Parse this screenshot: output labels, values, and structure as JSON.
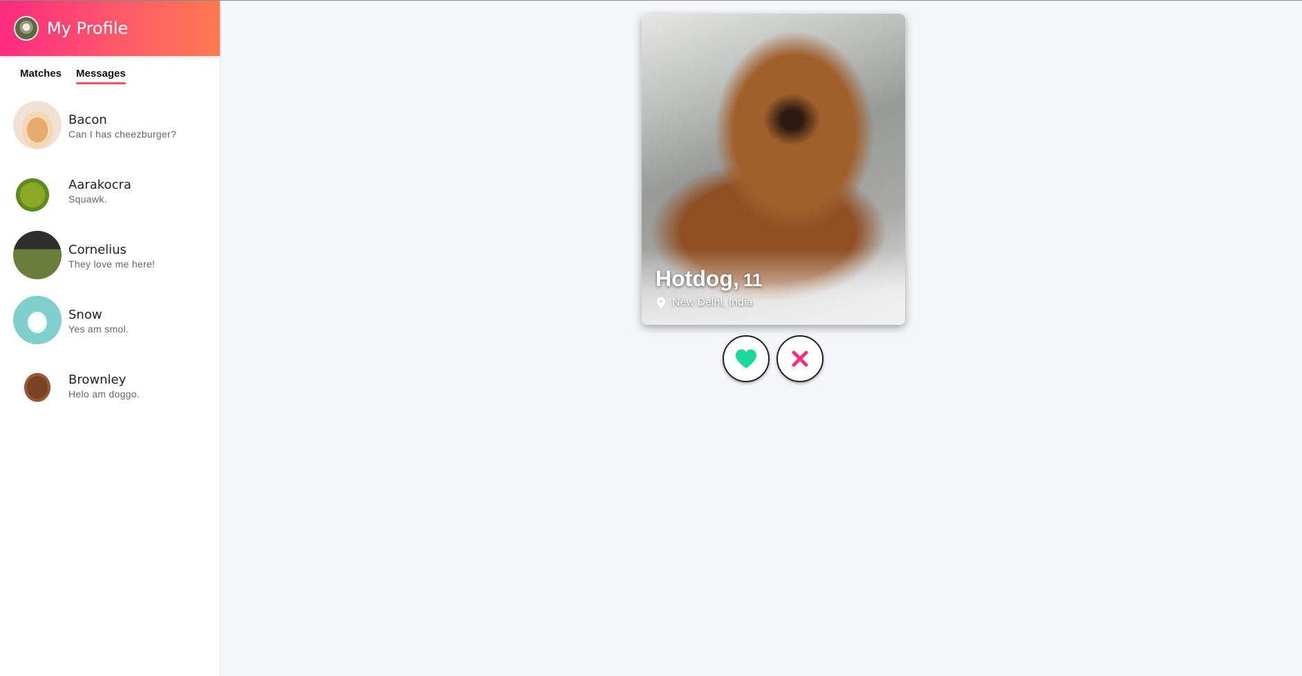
{
  "profile": {
    "title": "My Profile"
  },
  "tabs": [
    {
      "label": "Matches",
      "active": false
    },
    {
      "label": "Messages",
      "active": true
    }
  ],
  "conversations": [
    {
      "name": "Bacon",
      "preview": "Can I has cheezburger?",
      "avatar": "cat-avatar"
    },
    {
      "name": "Aarakocra",
      "preview": "Squawk.",
      "avatar": "parakeet-avatar"
    },
    {
      "name": "Cornelius",
      "preview": "They love me here!",
      "avatar": "pug-avatar"
    },
    {
      "name": "Snow",
      "preview": "Yes am smol.",
      "avatar": "white-puppy-avatar"
    },
    {
      "name": "Brownley",
      "preview": "Helo am doggo.",
      "avatar": "doodle-avatar"
    }
  ],
  "card": {
    "name": "Hotdog,",
    "age": "11",
    "location": "New Delhi, India",
    "photo": "dachshund-photo"
  },
  "actions": {
    "like_icon": "heart-icon",
    "nope_icon": "close-icon"
  },
  "colors": {
    "brand_gradient_start": "#fd2a7f",
    "brand_gradient_end": "#ff7a4f",
    "tab_underline": "#ff4e6a",
    "like": "#1bd99a",
    "nope": "#ff2e7a",
    "background": "#f5f6fa"
  }
}
